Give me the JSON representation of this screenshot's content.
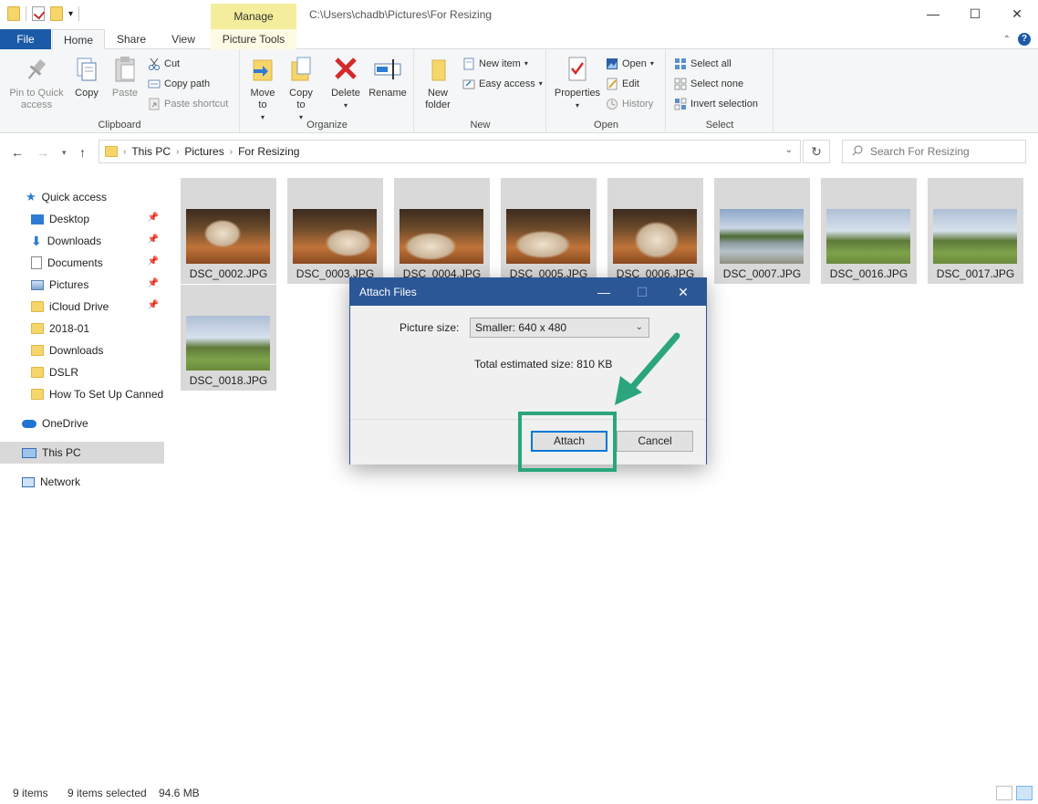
{
  "window": {
    "manage_tab": "Manage",
    "title_path": "C:\\Users\\chadb\\Pictures\\For Resizing",
    "minimize": "—",
    "maximize": "☐",
    "close": "✕"
  },
  "ribbon_tabs": {
    "file": "File",
    "home": "Home",
    "share": "Share",
    "view": "View",
    "picture_tools": "Picture Tools"
  },
  "ribbon": {
    "clipboard": {
      "label": "Clipboard",
      "pin": "Pin to Quick access",
      "copy": "Copy",
      "paste": "Paste",
      "cut": "Cut",
      "copy_path": "Copy path",
      "paste_shortcut": "Paste shortcut"
    },
    "organize": {
      "label": "Organize",
      "move_to": "Move to",
      "copy_to": "Copy to",
      "delete": "Delete",
      "rename": "Rename"
    },
    "new": {
      "label": "New",
      "new_folder": "New folder",
      "new_item": "New item",
      "easy_access": "Easy access"
    },
    "open": {
      "label": "Open",
      "properties": "Properties",
      "open": "Open",
      "edit": "Edit",
      "history": "History"
    },
    "select": {
      "label": "Select",
      "select_all": "Select all",
      "select_none": "Select none",
      "invert_selection": "Invert selection"
    }
  },
  "address": {
    "crumbs": [
      "This PC",
      "Pictures",
      "For Resizing"
    ],
    "search_placeholder": "Search For Resizing"
  },
  "sidebar": {
    "items": [
      {
        "label": "Quick access",
        "icon": "star-icon"
      },
      {
        "label": "Desktop",
        "icon": "desktop-icon",
        "pinned": true
      },
      {
        "label": "Downloads",
        "icon": "download-icon",
        "pinned": true
      },
      {
        "label": "Documents",
        "icon": "document-icon",
        "pinned": true
      },
      {
        "label": "Pictures",
        "icon": "pictures-icon",
        "pinned": true
      },
      {
        "label": "iCloud Drive",
        "icon": "folder-icon",
        "pinned": true
      },
      {
        "label": "2018-01",
        "icon": "folder-icon"
      },
      {
        "label": "Downloads",
        "icon": "folder-icon"
      },
      {
        "label": "DSLR",
        "icon": "folder-icon"
      },
      {
        "label": "How To Set Up Canned R",
        "icon": "folder-icon"
      },
      {
        "label": "OneDrive",
        "icon": "cloud-icon"
      },
      {
        "label": "This PC",
        "icon": "computer-icon",
        "selected": true
      },
      {
        "label": "Network",
        "icon": "network-icon"
      }
    ]
  },
  "files": [
    {
      "name": "DSC_0002.JPG",
      "kind": "dog"
    },
    {
      "name": "DSC_0003.JPG",
      "kind": "dog"
    },
    {
      "name": "DSC_0004.JPG",
      "kind": "dog"
    },
    {
      "name": "DSC_0005.JPG",
      "kind": "dog"
    },
    {
      "name": "DSC_0006.JPG",
      "kind": "dog"
    },
    {
      "name": "DSC_0007.JPG",
      "kind": "river"
    },
    {
      "name": "DSC_0016.JPG",
      "kind": "land"
    },
    {
      "name": "DSC_0017.JPG",
      "kind": "land"
    },
    {
      "name": "DSC_0018.JPG",
      "kind": "land"
    }
  ],
  "dialog": {
    "title": "Attach Files",
    "picture_size_label": "Picture size:",
    "picture_size_value": "Smaller: 640 x 480",
    "total_label": "Total estimated size:",
    "total_value": "810 KB",
    "attach": "Attach",
    "cancel": "Cancel",
    "highlight_color": "#2aa57e"
  },
  "status": {
    "items": "9 items",
    "selected": "9 items selected",
    "size": "94.6 MB"
  }
}
